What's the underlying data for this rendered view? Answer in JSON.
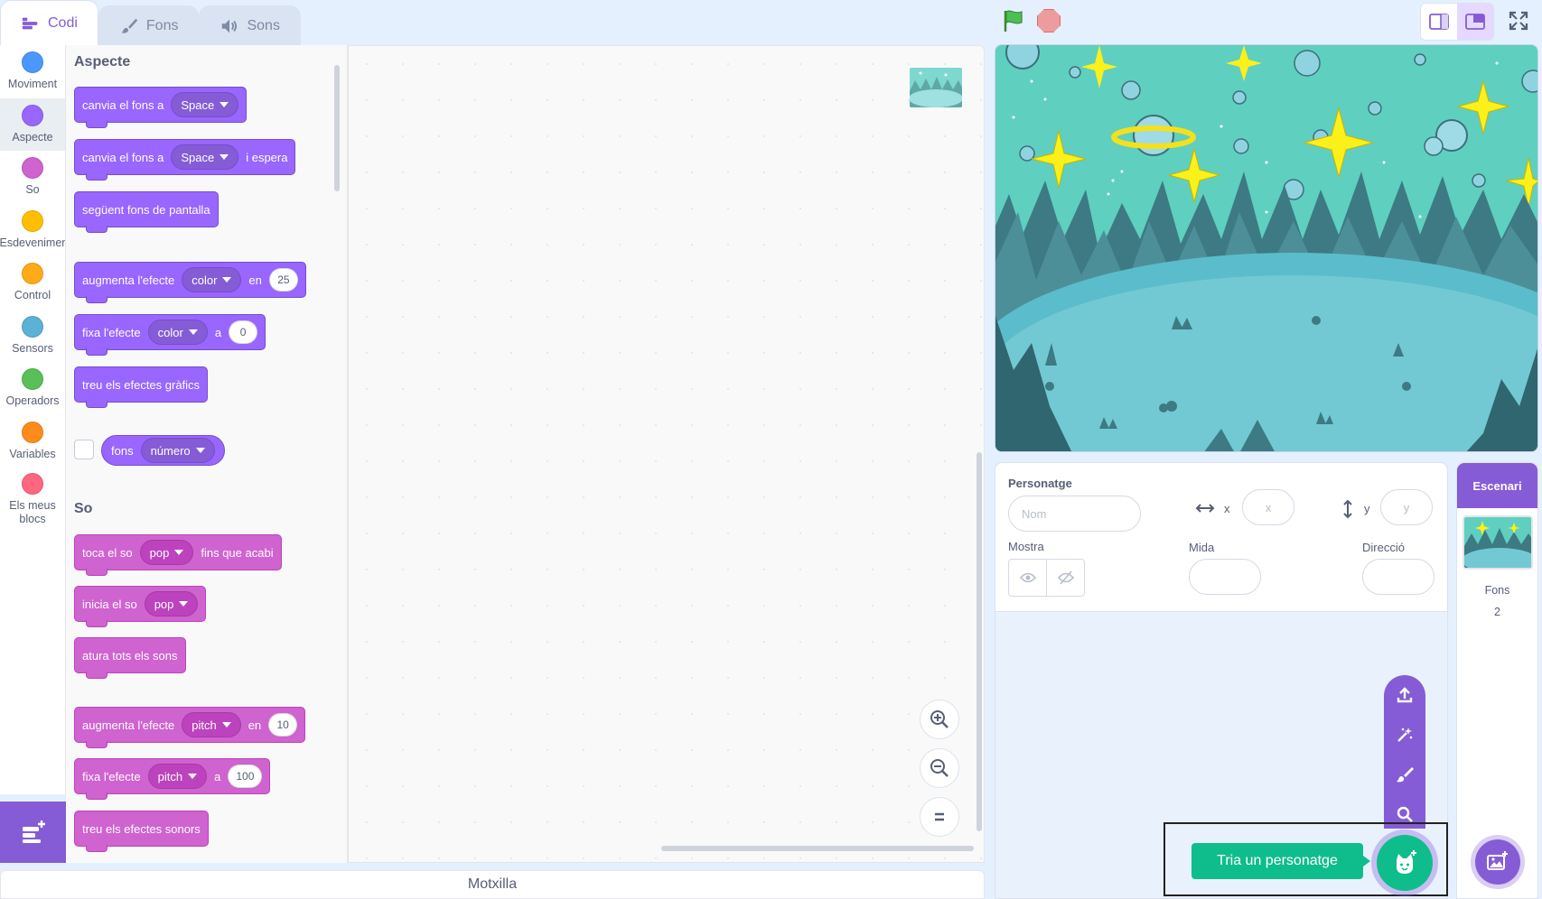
{
  "tabs": [
    {
      "label": "Codi",
      "icon": "code-icon"
    },
    {
      "label": "Fons",
      "icon": "brush-icon"
    },
    {
      "label": "Sons",
      "icon": "speaker-icon"
    }
  ],
  "categories": [
    {
      "label": "Moviment",
      "color": "#4c97ff"
    },
    {
      "label": "Aspecte",
      "color": "#9966ff"
    },
    {
      "label": "So",
      "color": "#cf63cf"
    },
    {
      "label": "Esdeveniments",
      "color": "#ffbf00"
    },
    {
      "label": "Control",
      "color": "#ffab19"
    },
    {
      "label": "Sensors",
      "color": "#5cb1d6"
    },
    {
      "label": "Operadors",
      "color": "#59c059"
    },
    {
      "label": "Variables",
      "color": "#ff8c1a"
    },
    {
      "label": "Els meus blocs",
      "color": "#ff6680"
    }
  ],
  "palette": {
    "looks_title": "Aspecte",
    "sound_title": "So",
    "looks_blocks": {
      "switch_backdrop": {
        "text": "canvia el fons a",
        "menu": "Space"
      },
      "switch_backdrop_wait": {
        "text": "canvia el fons a",
        "menu": "Space",
        "suffix": "i espera"
      },
      "next_backdrop": {
        "text": "següent fons de pantalla"
      },
      "change_effect": {
        "text": "augmenta l'efecte",
        "menu": "color",
        "mid": "en",
        "value": "25"
      },
      "set_effect": {
        "text": "fixa l'efecte",
        "menu": "color",
        "mid": "a",
        "value": "0"
      },
      "clear_effects": {
        "text": "treu els efectes gràfics"
      },
      "backdrop_reporter": {
        "text": "fons",
        "menu": "número"
      }
    },
    "sound_blocks": {
      "play_until_done": {
        "text": "toca el so",
        "menu": "pop",
        "suffix": "fins que acabi"
      },
      "start_sound": {
        "text": "inicia el so",
        "menu": "pop"
      },
      "stop_all": {
        "text": "atura tots els sons"
      },
      "change_effect": {
        "text": "augmenta l'efecte",
        "menu": "pitch",
        "mid": "en",
        "value": "10"
      },
      "set_effect": {
        "text": "fixa l'efecte",
        "menu": "pitch",
        "mid": "a",
        "value": "100"
      },
      "clear_effects": {
        "text": "treu els efectes sonors"
      }
    }
  },
  "backpack": {
    "label": "Motxilla"
  },
  "sprite_info": {
    "title": "Personatge",
    "name_placeholder": "Nom",
    "x_label": "x",
    "x_placeholder": "x",
    "y_label": "y",
    "y_placeholder": "y",
    "show_label": "Mostra",
    "size_label": "Mida",
    "direction_label": "Direcció"
  },
  "stage_panel": {
    "header": "Escenari",
    "backdrops_label": "Fons",
    "backdrops_count": "2"
  },
  "add_sprite": {
    "tooltip": "Tria un personatge",
    "menu_icons": [
      "upload-icon",
      "surprise-icon",
      "paint-icon",
      "search-icon"
    ]
  },
  "colors": {
    "accent": "#855cd6",
    "looks": "#9966ff",
    "sound": "#cf63cf",
    "green": "#0fbd8c"
  }
}
